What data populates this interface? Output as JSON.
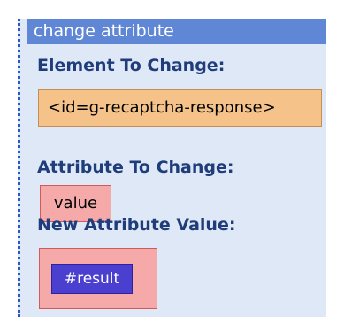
{
  "panel": {
    "title": "change attribute",
    "element_label": "Element To Change:",
    "element_value": "<id=g-recaptcha-response>",
    "attribute_label": "Attribute To Change:",
    "attribute_value": "value",
    "new_value_label": "New Attribute Value:",
    "new_value_chip": "#result"
  },
  "colors": {
    "panel_bg": "#dfe8f6",
    "title_bg": "#5f87d6",
    "label_text": "#1f3d7a",
    "element_box": "#f5c38a",
    "attribute_box": "#f5a9a9",
    "chip_bg": "#4a3fcf"
  }
}
